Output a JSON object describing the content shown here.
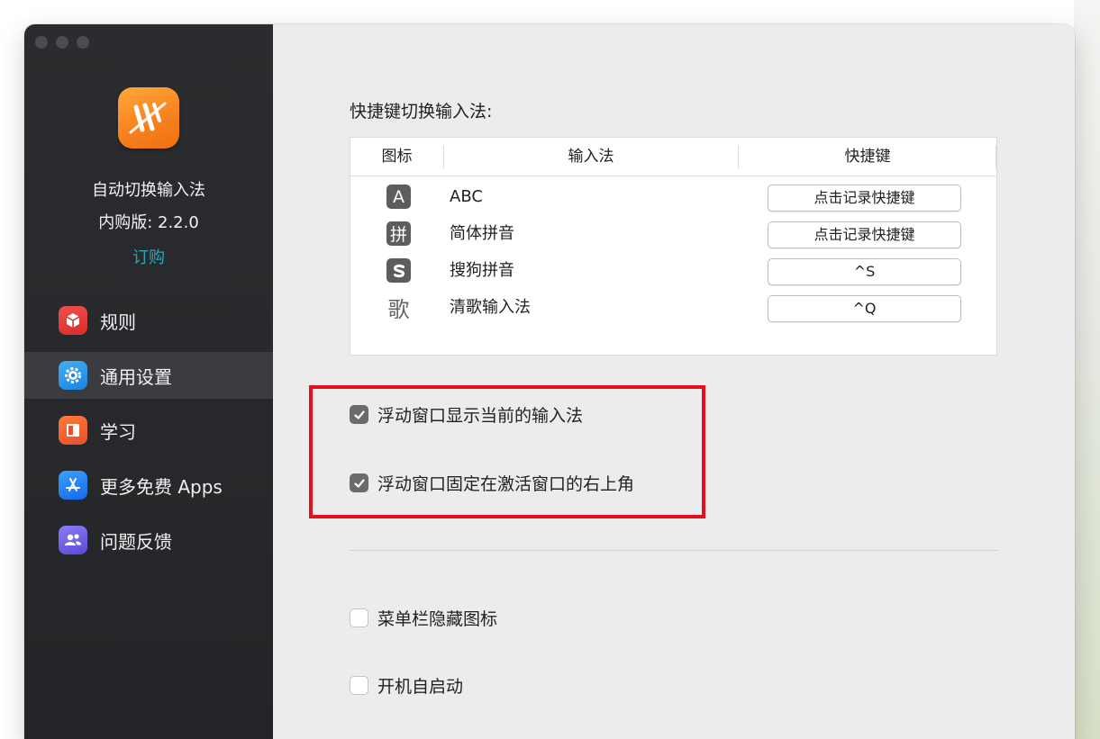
{
  "sidebar": {
    "app_name": "自动切换输入法",
    "version": "内购版: 2.2.0",
    "buy_label": "订购",
    "items": [
      {
        "label": "规则",
        "icon": "box-icon"
      },
      {
        "label": "通用设置",
        "icon": "gear-icon",
        "active": true
      },
      {
        "label": "学习",
        "icon": "book-icon"
      },
      {
        "label": "更多免费 Apps",
        "icon": "app-store-icon"
      },
      {
        "label": "问题反馈",
        "icon": "people-icon"
      }
    ]
  },
  "shortcuts": {
    "title": "快捷键切换输入法:",
    "headers": [
      "图标",
      "输入法",
      "快捷键"
    ],
    "rows": [
      {
        "icon_glyph": "A",
        "name": "ABC",
        "shortcut": "点击记录快捷键"
      },
      {
        "icon_glyph": "拼",
        "name": "简体拼音",
        "shortcut": "点击记录快捷键"
      },
      {
        "icon_glyph": "S",
        "name": "搜狗拼音",
        "shortcut": "^S"
      },
      {
        "icon_glyph": "歌",
        "name": "清歌输入法",
        "shortcut": "^Q"
      }
    ]
  },
  "options": [
    {
      "label": "浮动窗口显示当前的输入法",
      "checked": true
    },
    {
      "label": "浮动窗口固定在激活窗口的右上角",
      "checked": true
    },
    {
      "label": "菜单栏隐藏图标",
      "checked": false
    },
    {
      "label": "开机自启动",
      "checked": false
    }
  ],
  "colors": {
    "accent_link": "#2fa6b8",
    "highlight_box": "#e3101f",
    "app_icon": "#f7831f"
  }
}
